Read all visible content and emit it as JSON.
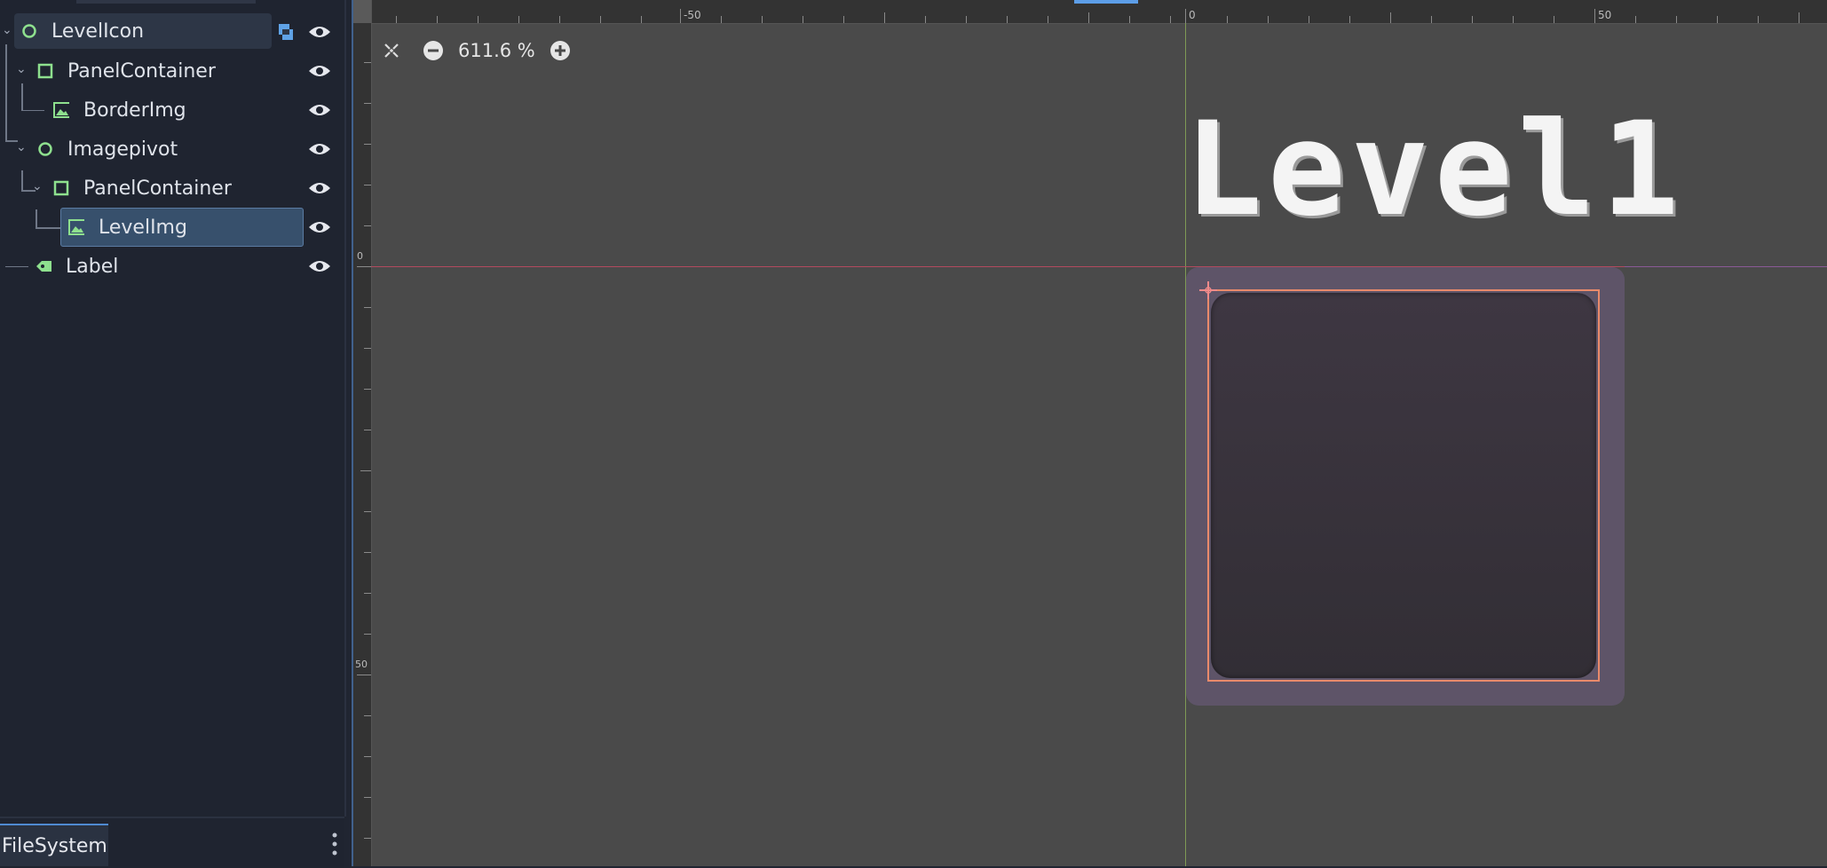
{
  "scene_tree": {
    "nodes": [
      {
        "label": "LevelIcon",
        "type": "node2d",
        "icon": "node2d-circle-icon"
      },
      {
        "label": "PanelContainer",
        "type": "container",
        "icon": "container-square-icon"
      },
      {
        "label": "BorderImg",
        "type": "texture-rect",
        "icon": "image-icon"
      },
      {
        "label": "Imagepivot",
        "type": "node2d",
        "icon": "node2d-circle-icon"
      },
      {
        "label": "PanelContainer",
        "type": "container",
        "icon": "container-square-icon"
      },
      {
        "label": "LevelImg",
        "type": "texture-rect",
        "icon": "image-icon"
      },
      {
        "label": "Label",
        "type": "label",
        "icon": "label-tag-icon"
      }
    ],
    "selected": "LevelImg",
    "accent_color": "#8ee08e"
  },
  "bottom_dock": {
    "tab_label": "FileSystem"
  },
  "viewport": {
    "zoom_text": "611.6 %",
    "ruler_labels": {
      "h_neg50": "-50",
      "h_zero": "0",
      "h_pos50": "50",
      "v_zero": "0",
      "v_pos50": "50"
    },
    "canvas_text": "Level1",
    "colors": {
      "background": "#4a4a4a",
      "x_axis": "#b24a5f",
      "y_axis": "#7f9a55",
      "selection_outline": "#e98a6b",
      "border_panel": "#5e5468"
    }
  }
}
